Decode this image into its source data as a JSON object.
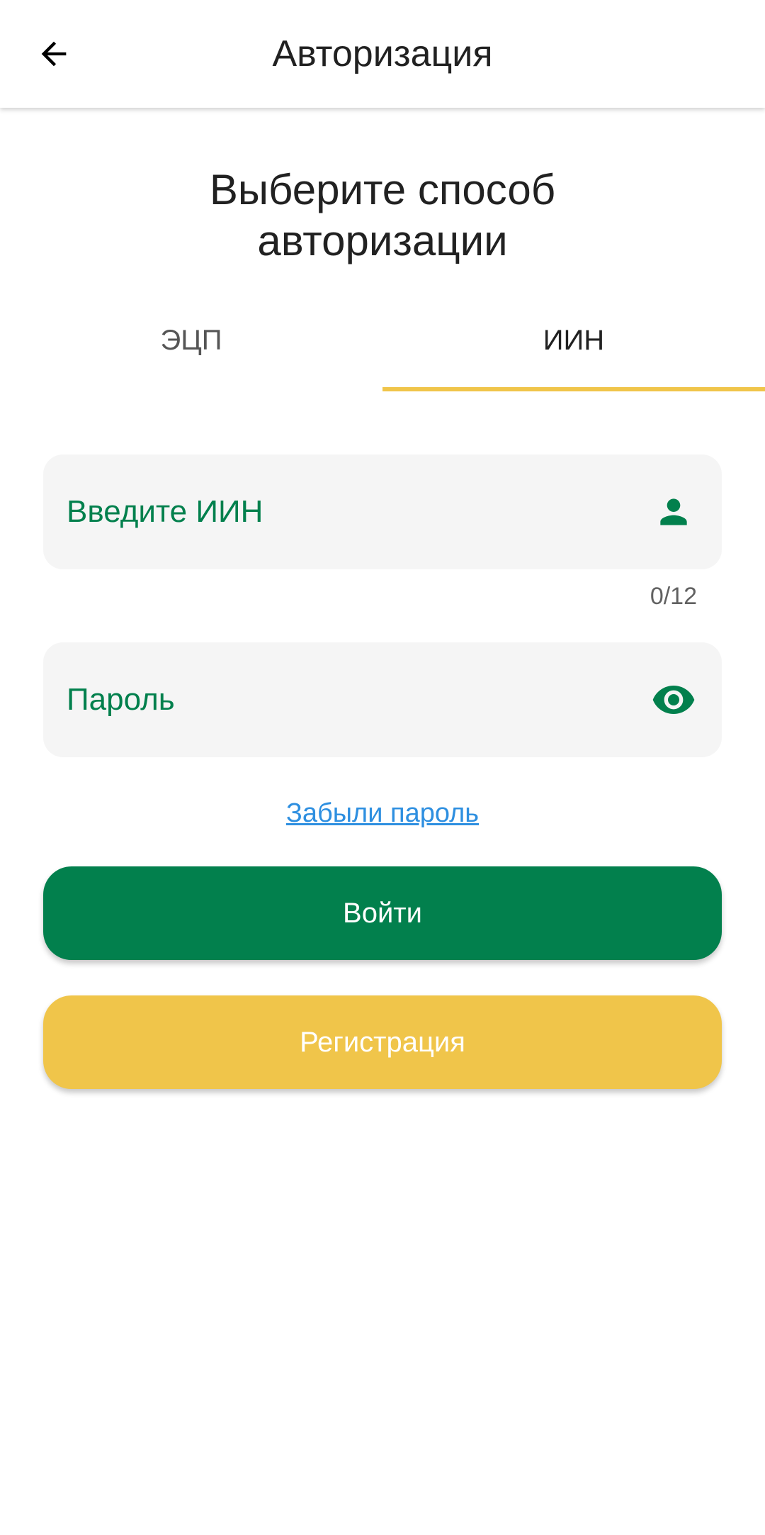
{
  "app_bar": {
    "title": "Авторизация",
    "back_icon": "arrow-left-icon"
  },
  "heading": {
    "line1": "Выберите способ",
    "line2": "авторизации"
  },
  "tabs": [
    {
      "label": "ЭЦП",
      "active": false
    },
    {
      "label": "ИИН",
      "active": true
    }
  ],
  "iin_field": {
    "placeholder": "Введите ИИН",
    "value": "",
    "icon": "person-icon",
    "counter": "0/12"
  },
  "password_field": {
    "placeholder": "Пароль",
    "value": "",
    "icon": "eye-icon"
  },
  "forgot_password": "Забыли пароль",
  "buttons": {
    "login": "Войти",
    "register": "Регистрация"
  },
  "colors": {
    "primary_green": "#02804D",
    "accent_yellow": "#F0C54A",
    "link_blue": "#2E8FE0",
    "field_bg": "#F5F5F5"
  }
}
